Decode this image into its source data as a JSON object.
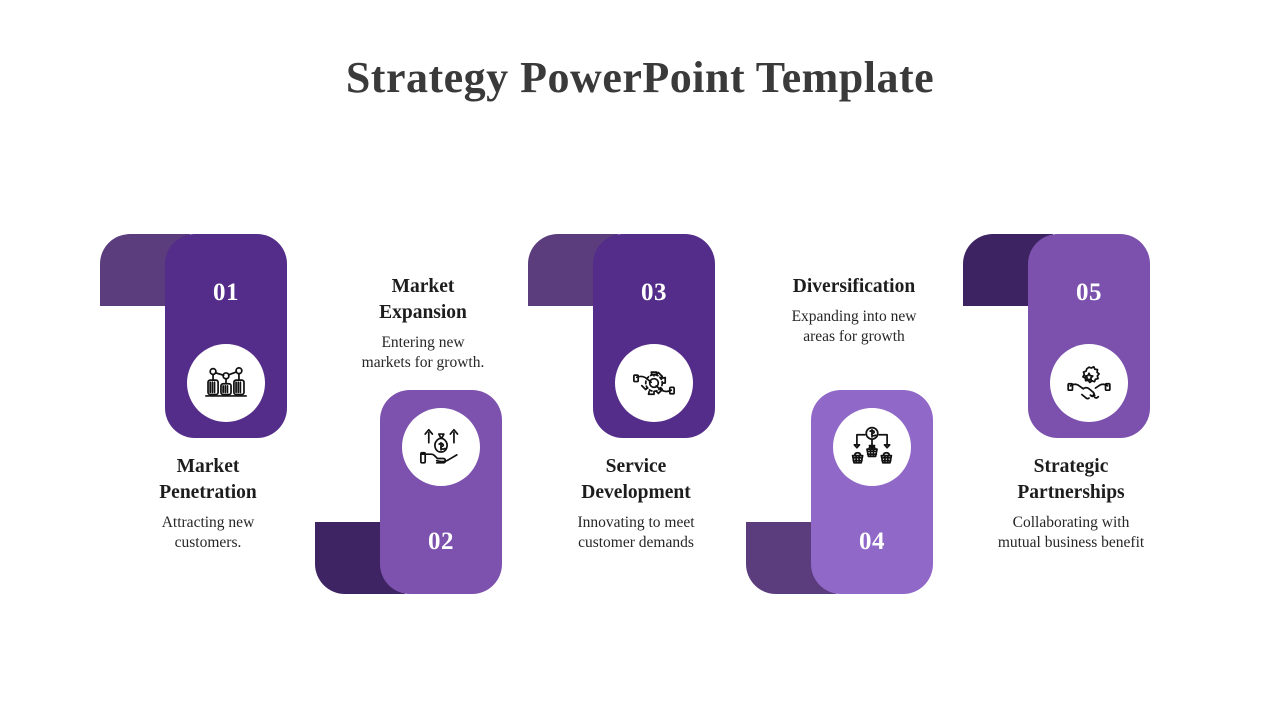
{
  "slide": {
    "title": "Strategy PowerPoint Template",
    "title_color": "#3a3a3a",
    "background": "#ffffff"
  },
  "palette": {
    "card_1": "#542D8A",
    "tab_1": "#5B3D7E",
    "card_2": "#7D51AE",
    "tab_2": "#3F2463",
    "card_3": "#542D8A",
    "tab_3": "#5B3D7E",
    "card_4": "#9068C8",
    "tab_4": "#5B3D7E",
    "card_5": "#7B51AD",
    "tab_5": "#3E2363",
    "icon_bubble": "#ffffff",
    "icon_stroke": "#111111",
    "text_dark": "#1d1d1d"
  },
  "steps": [
    {
      "number": "01",
      "title": "Market Penetration",
      "title_line1": "Market",
      "title_line2": "Penetration",
      "description": "Attracting new customers.",
      "desc_line1": "Attracting new",
      "desc_line2": "customers.",
      "icon": "people-growth-chart-icon",
      "orientation": "up",
      "card_color": "#542D8A",
      "tab_color": "#5B3D7E"
    },
    {
      "number": "02",
      "title": "Market Expansion",
      "title_line1": "Market",
      "title_line2": "Expansion",
      "description": "Entering new markets for growth.",
      "desc_line1": "Entering new",
      "desc_line2": "markets for growth.",
      "icon": "hand-money-bag-growth-icon",
      "orientation": "down",
      "card_color": "#7D51AE",
      "tab_color": "#3F2463"
    },
    {
      "number": "03",
      "title": "Service Development",
      "title_line1": "Service",
      "title_line2": "Development",
      "description": "Innovating to meet customer demands",
      "desc_line1": "Innovating to meet",
      "desc_line2": "customer demands",
      "icon": "gear-in-hands-icon",
      "orientation": "up",
      "card_color": "#542D8A",
      "tab_color": "#5B3D7E"
    },
    {
      "number": "04",
      "title": "Diversification",
      "title_line1": "Diversification",
      "title_line2": "",
      "description": "Expanding into new areas for growth",
      "desc_line1": "Expanding into new",
      "desc_line2": "areas for growth",
      "icon": "dollar-distribution-baskets-icon",
      "orientation": "down",
      "card_color": "#9068C8",
      "tab_color": "#5B3D7E"
    },
    {
      "number": "05",
      "title": "Strategic Partnerships",
      "title_line1": "Strategic",
      "title_line2": "Partnerships",
      "description": "Collaborating with mutual business benefit",
      "desc_line1": "Collaborating with",
      "desc_line2": "mutual business benefit",
      "icon": "handshake-gear-icon",
      "orientation": "up",
      "card_color": "#7B51AD",
      "tab_color": "#3E2363"
    }
  ]
}
